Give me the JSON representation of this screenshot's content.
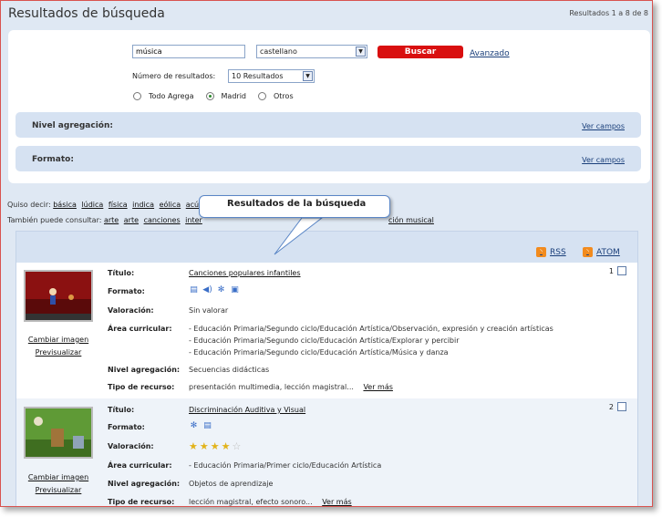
{
  "header": {
    "title": "Resultados de búsqueda",
    "result_count": "Resultados 1 a 8 de 8"
  },
  "search": {
    "query": "música",
    "language": "castellano",
    "search_button": "Buscar",
    "advanced_link": "Avanzado",
    "num_results_label": "Número de resultados:",
    "num_results_value": "10 Resultados",
    "scopes": [
      {
        "label": "Todo Agrega",
        "selected": false
      },
      {
        "label": "Madrid",
        "selected": true
      },
      {
        "label": "Otros",
        "selected": false
      }
    ]
  },
  "facets": [
    {
      "label": "Nivel agregación:",
      "link": "Ver campos"
    },
    {
      "label": "Formato:",
      "link": "Ver campos"
    }
  ],
  "suggestions": {
    "did_you_mean_label": "Quiso decir:",
    "did_you_mean": [
      "básica",
      "lúdica",
      "física",
      "indica",
      "eólica",
      "acús"
    ],
    "also_label": "También puede consultar:",
    "also": [
      "arte",
      "arte",
      "canciones",
      "inter"
    ],
    "also_tail": "ción musical"
  },
  "callout": {
    "text": "Resultados de la búsqueda"
  },
  "feeds": {
    "rss": "RSS",
    "atom": "ATOM"
  },
  "labels": {
    "titulo": "Título:",
    "formato": "Formato:",
    "valoracion": "Valoración:",
    "area": "Área curricular:",
    "nivel": "Nivel agregación:",
    "tipo": "Tipo de recurso:",
    "change_image": "Cambiar imagen",
    "preview": "Previsualizar",
    "more": "Ver más"
  },
  "results": [
    {
      "number": "1",
      "title": "Canciones populares infantiles",
      "format_icons": [
        "document-icon",
        "audio-icon",
        "settings-icon",
        "image-icon"
      ],
      "rating_text": "Sin valorar",
      "areas": [
        "- Educación Primaria/Segundo ciclo/Educación Artística/Observación, expresión y creación artísticas",
        "- Educación Primaria/Segundo ciclo/Educación Artística/Explorar y percibir",
        "- Educación Primaria/Segundo ciclo/Educación Artística/Música y danza"
      ],
      "level": "Secuencias didácticas",
      "type": "presentación multimedia, lección magistral..."
    },
    {
      "number": "2",
      "title": "Discriminación Auditiva y Visual",
      "format_icons": [
        "settings-icon",
        "document-icon"
      ],
      "rating_stars": 4,
      "rating_max": 5,
      "areas": [
        "- Educación Primaria/Primer ciclo/Educación Artística"
      ],
      "level": "Objetos de aprendizaje",
      "type": "lección magistral, efecto sonoro..."
    }
  ],
  "colors": {
    "accent_red": "#d90f0f",
    "panel_blue": "#d6e2f2",
    "feed_orange": "#f28b1e"
  }
}
